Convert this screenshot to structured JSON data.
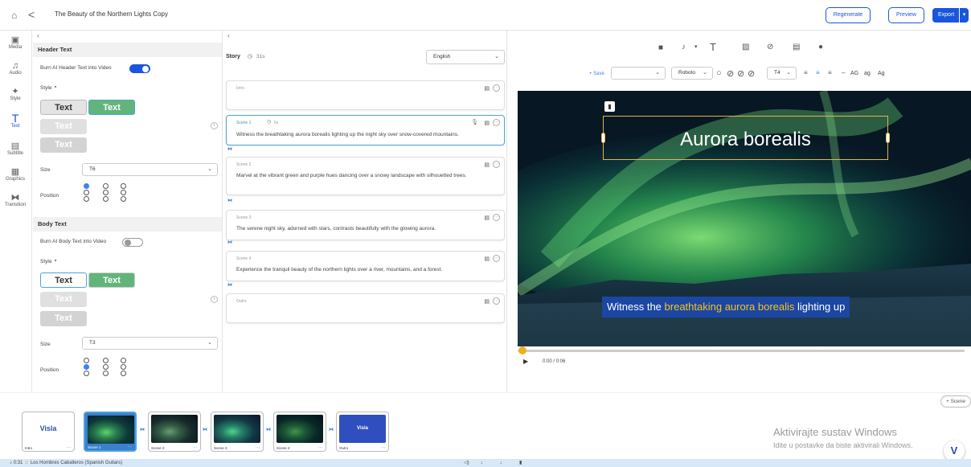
{
  "header": {
    "title": "The Beauty of the Northern Lights Copy",
    "regenerate": "Regenerate",
    "preview": "Preview",
    "export": "Export"
  },
  "nav": [
    {
      "label": "Media",
      "icon": "media-icon"
    },
    {
      "label": "Audio",
      "icon": "music-icon"
    },
    {
      "label": "Style",
      "icon": "style-icon"
    },
    {
      "label": "Text",
      "icon": "text-icon"
    },
    {
      "label": "Subtitle",
      "icon": "subtitle-icon"
    },
    {
      "label": "Graphics",
      "icon": "graphics-icon"
    },
    {
      "label": "Transition",
      "icon": "transition-icon"
    }
  ],
  "text_panel": {
    "header_section": "Header Text",
    "burn_header": "Burn AI Header Text into Video",
    "style_label": "Style",
    "size_label": "Size",
    "size_value": "T6",
    "position_label": "Position",
    "body_section": "Body Text",
    "burn_body": "Burn AI Body Text into Video",
    "body_size_value": "T3",
    "sample": "Text"
  },
  "story": {
    "label": "Story",
    "duration": "31s",
    "language": "English",
    "scenes": [
      {
        "name": "Intro",
        "text": ""
      },
      {
        "name": "Scene 1",
        "duration": "6s",
        "text": "Witness the breathtaking aurora borealis lighting up the night sky over snow-covered mountains."
      },
      {
        "name": "Scene 2",
        "text": "Marvel at the vibrant green and purple hues dancing over a snowy landscape with silhouetted trees."
      },
      {
        "name": "Scene 3",
        "text": "The serene night sky, adorned with stars, contrasts beautifully with the glowing aurora."
      },
      {
        "name": "Scene 4",
        "text": "Experience the tranquil beauty of the northern lights over a river, mountains, and a forest."
      },
      {
        "name": "Outro",
        "text": ""
      }
    ]
  },
  "editor": {
    "save": "+ Save",
    "font": "Roboto",
    "size": "T4",
    "case_upper": "AG",
    "case_lower": "ag",
    "case_title": "Ag"
  },
  "preview": {
    "header_text": "Aurora borealis",
    "sub_pre": "Witness the ",
    "sub_hl": "breathtaking aurora borealis",
    "sub_post": " lighting up",
    "time": "0:00 / 0:06"
  },
  "timeline": {
    "add_scene": "+ Scene",
    "thumbs": [
      "Intro",
      "Scene 1",
      "Scene 2",
      "Scene 3",
      "Scene 4",
      "Outro"
    ],
    "brand": "Visla"
  },
  "music": {
    "time": "0:31",
    "track": "Los Hombres Caballeros (Spanish Guitars)"
  },
  "watermark": {
    "line1": "Aktivirajte sustav Windows",
    "line2": "Idite u postavke da biste aktivirali Windows."
  }
}
